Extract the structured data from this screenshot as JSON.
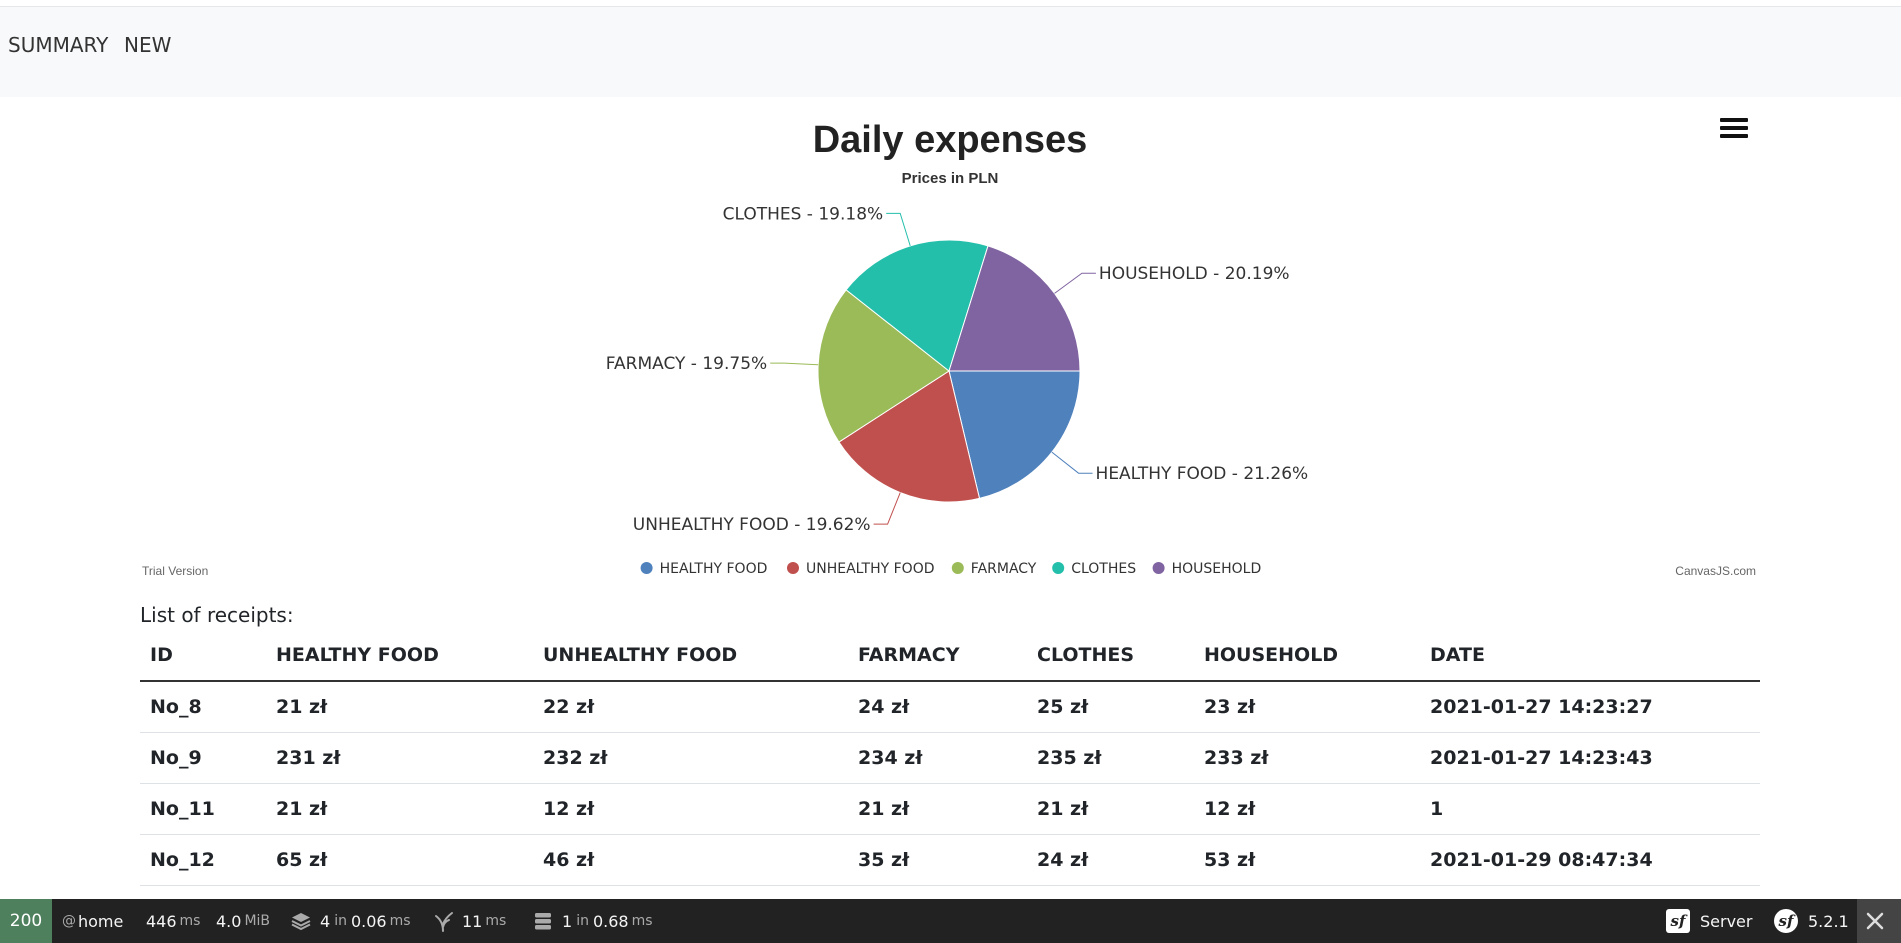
{
  "nav": {
    "items": [
      {
        "label": "SUMMARY"
      },
      {
        "label": "NEW"
      }
    ]
  },
  "chart_data": {
    "type": "pie",
    "title": "Daily expenses",
    "subtitle": "Prices in PLN",
    "slices": [
      {
        "label": "HEALTHY FOOD",
        "value": 21.26,
        "display": "HEALTHY FOOD - 21.26%",
        "color": "#4f81bc"
      },
      {
        "label": "UNHEALTHY FOOD",
        "value": 19.62,
        "display": "UNHEALTHY FOOD - 19.62%",
        "color": "#c0504e"
      },
      {
        "label": "FARMACY",
        "value": 19.75,
        "display": "FARMACY - 19.75%",
        "color": "#9bbb58"
      },
      {
        "label": "CLOTHES",
        "value": 19.18,
        "display": "CLOTHES - 19.18%",
        "color": "#23bfaa"
      },
      {
        "label": "HOUSEHOLD",
        "value": 20.19,
        "display": "HOUSEHOLD - 20.19%",
        "color": "#8064a1"
      }
    ],
    "legend_position": "bottom-center",
    "trial_text": "Trial Version",
    "credit_text": "CanvasJS.com",
    "menu_icon": "hamburger-menu-icon"
  },
  "receipts": {
    "label": "List of receipts:",
    "columns": [
      "ID",
      "HEALTHY FOOD",
      "UNHEALTHY FOOD",
      "FARMACY",
      "CLOTHES",
      "HOUSEHOLD",
      "DATE"
    ],
    "rows": [
      [
        "No_8",
        "21 zł",
        "22 zł",
        "24 zł",
        "25 zł",
        "23 zł",
        "2021-01-27 14:23:27"
      ],
      [
        "No_9",
        "231 zł",
        "232 zł",
        "234 zł",
        "235 zł",
        "233 zł",
        "2021-01-27 14:23:43"
      ],
      [
        "No_11",
        "21 zł",
        "12 zł",
        "21 zł",
        "21 zł",
        "12 zł",
        "1"
      ],
      [
        "No_12",
        "65 zł",
        "46 zł",
        "35 zł",
        "24 zł",
        "53 zł",
        "2021-01-29 08:47:34"
      ]
    ]
  },
  "debugbar": {
    "status": "200",
    "status_color": "#4f805d",
    "route_prefix": "@",
    "route": "home",
    "time_value": "446",
    "time_unit": "ms",
    "memory_value": "4.0",
    "memory_unit": "MiB",
    "forms_count": "4",
    "forms_in": "in",
    "forms_time": "0.06",
    "forms_unit": "ms",
    "twig_value": "11",
    "twig_unit": "ms",
    "db_count": "1",
    "db_in": "in",
    "db_time": "0.68",
    "db_unit": "ms",
    "server_label": "Server",
    "version": "5.2.1",
    "icons": [
      "layers-icon",
      "twig-icon",
      "database-icon",
      "symfony-icon",
      "close-icon"
    ]
  }
}
